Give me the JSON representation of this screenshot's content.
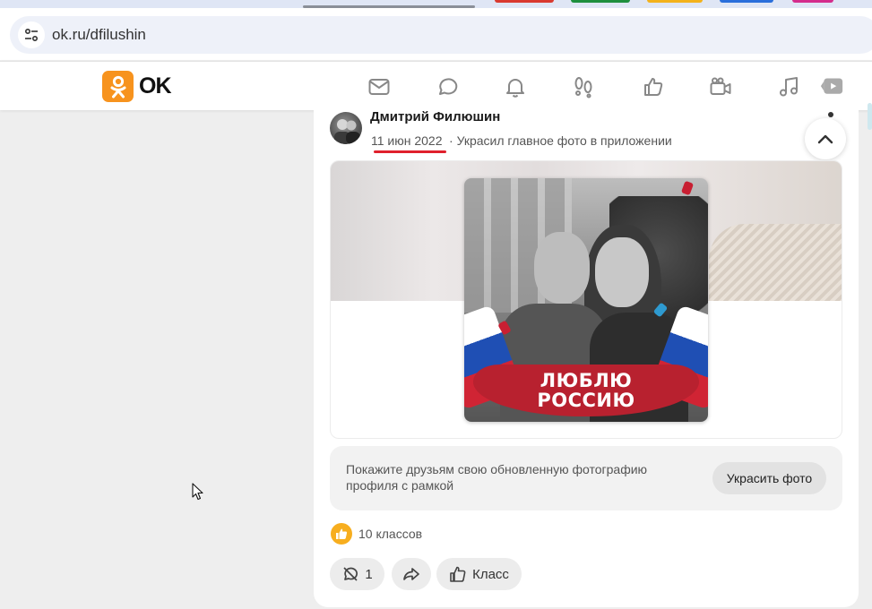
{
  "browser": {
    "url": "ok.ru/dfilushin",
    "tab_colors": [
      "#d93a2f",
      "#1e8f3e",
      "#f3b21b",
      "#2a6fdb",
      "#d42d8c"
    ]
  },
  "header": {
    "logo_text": "OK",
    "brand_color": "#f7931e",
    "nav_icons": [
      "messages-icon",
      "discussions-icon",
      "notifications-icon",
      "guests-icon",
      "events-icon",
      "video-calls-icon",
      "music-icon",
      "video-icon"
    ]
  },
  "post": {
    "author": "Дмитрий Филюшин",
    "date": "11 июн 2022",
    "separator": "·",
    "action": "Украсил главное фото в приложении",
    "photo_banner_line1": "ЛЮБЛЮ",
    "photo_banner_line2": "РОССИЮ",
    "promo_text": "Покажите друзьям свою обновленную фотографию профиля с рамкой",
    "promo_button": "Украсить фото",
    "likes_text": "10 классов",
    "comments_count": "1",
    "class_button": "Класс",
    "accent_color": "#e0202c",
    "like_color": "#f7ae1f"
  }
}
